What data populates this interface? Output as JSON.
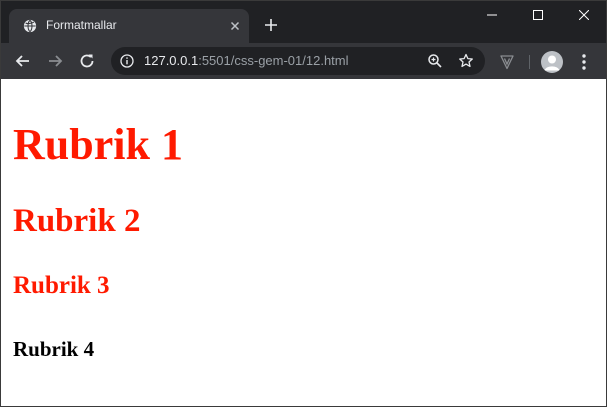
{
  "browser": {
    "tab": {
      "title": "Formatmallar",
      "favicon": "globe-icon"
    },
    "address_bar": {
      "host": "127.0.0.1",
      "path": ":5501/css-gem-01/12.html"
    },
    "colors": {
      "frame": "#202124",
      "toolbar": "#35363a",
      "omnibox": "#202124",
      "text": "#e8eaed"
    }
  },
  "page": {
    "headings": [
      {
        "level": 1,
        "text": "Rubrik 1",
        "color": "#ff1a00"
      },
      {
        "level": 2,
        "text": "Rubrik 2",
        "color": "#ff1a00"
      },
      {
        "level": 3,
        "text": "Rubrik 3",
        "color": "#ff1a00"
      },
      {
        "level": 4,
        "text": "Rubrik 4",
        "color": "#000000"
      }
    ]
  }
}
